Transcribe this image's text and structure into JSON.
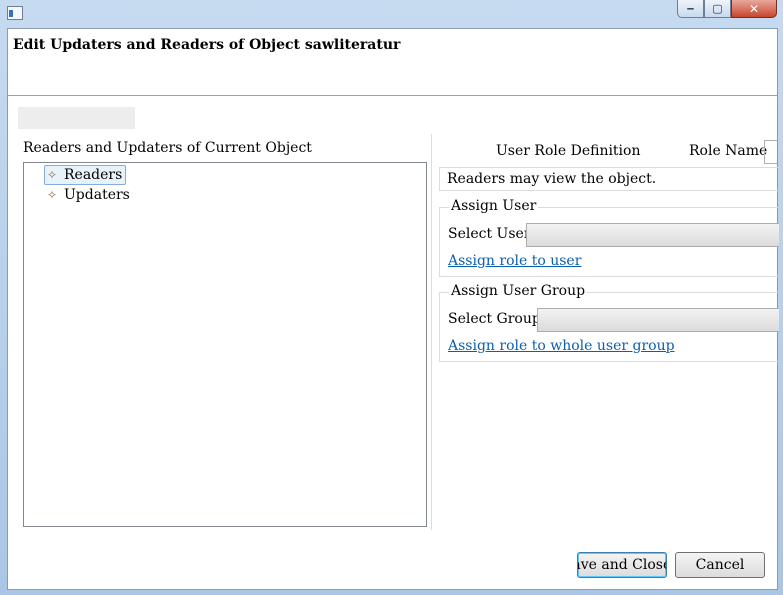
{
  "window": {
    "title": "",
    "controls": {
      "minimize_icon": "minimize-icon",
      "maximize_icon": "maximize-icon",
      "close_icon": "close-icon"
    }
  },
  "header": {
    "title": "Edit Updaters and Readers of Object sawliteratur"
  },
  "left_panel": {
    "title": "Readers and Updaters of Current Object",
    "tree": [
      {
        "label": "Readers",
        "icon": "role-icon",
        "selected": true
      },
      {
        "label": "Updaters",
        "icon": "role-icon",
        "selected": false
      }
    ]
  },
  "right_panel": {
    "tabs": [
      "User Role Definition",
      "Role Name"
    ],
    "description": "Readers may view the object.",
    "assign_user": {
      "legend": "Assign User",
      "select_label": "Select User",
      "select_value": "",
      "link": "Assign role to user"
    },
    "assign_group": {
      "legend": "Assign User Group",
      "select_label": "Select Group",
      "select_value": "",
      "link": "Assign role to whole user group"
    }
  },
  "footer": {
    "save_label": "Save and Close",
    "cancel_label": "Cancel"
  },
  "colors": {
    "link": "#0a5fb0",
    "selection_border": "#84acdd",
    "selection_bg": "#e8f2fb"
  }
}
